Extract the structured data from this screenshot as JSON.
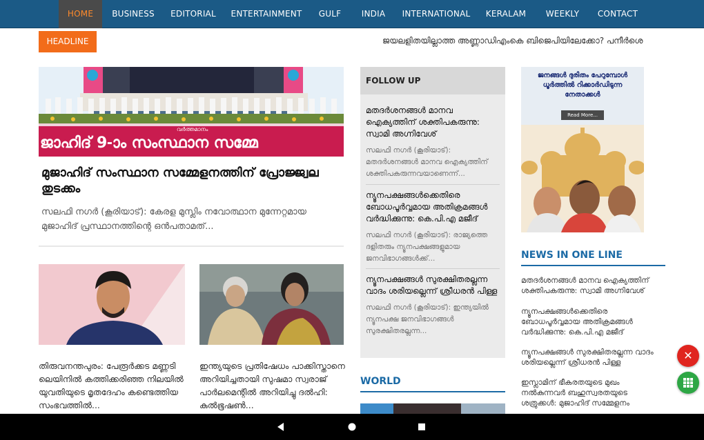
{
  "nav": {
    "items": [
      "HOME",
      "BUSINESS",
      "EDITORIAL",
      "ENTERTAINMENT",
      "GULF",
      "INDIA",
      "INTERNATIONAL",
      "KERALAM",
      "WEEKLY",
      "CONTACT"
    ],
    "active": "HOME"
  },
  "headline": {
    "label": "HEADLINE",
    "ticker": "ജയലളിതയില്ലാത്ത അണ്ണാഡിഎംകെ ബിജെപിയിലേക്കോ? പനീർശെ"
  },
  "hero": {
    "banner_text": "ജാഹിദ് 9-ാം സംസ്ഥാന സമ്മേ",
    "banner_logo": "വർത്തമാനം",
    "title": "മുജാഹിദ് സംസ്ഥാന സമ്മേളനത്തിന് പ്രോജ്ജ്വല തുടക്കം",
    "excerpt": "സലഫി നഗർ (കൂരിയാട്): കേരള മുസ്ലിം നവോത്ഥാന മുന്നേറ്റമായ മുജാഹിദ് പ്രസ്ഥാനത്തിന്റെ ഒൻപതാമത്..."
  },
  "cards": [
    {
      "text": "തിരുവനന്തപുരം: പേരൂർക്കട മണ്ണടി ലെയിനിൽ കത്തിക്കരിഞ്ഞ നിലയിൽ യുവതിയുടെ മൃതദേഹം കണ്ടെത്തിയ സംഭവത്തിൽ..."
    },
    {
      "text": "ഇന്ത്യയുടെ പ്രതിഷേധം പാക്കിസ്താനെ അറിയിച്ചതായി സുഷമാ സ്വരാജ് പാർലമെന്റിൽ അറിയിച്ചു ദൽഹി: കുൽഭൂഷൺ..."
    }
  ],
  "follow_up": {
    "heading": "FOLLOW UP",
    "items": [
      {
        "title": "മതദർശനങ്ങൾ മാനവ ഐക്യത്തിന് ശക്തിപകരുന്നു: സ്വാമി അഗ്നിവേശ്",
        "excerpt": "സലഫി നഗർ (കൂരിയാട്): മതദർശനങ്ങൾ മാനവ ഐക്യത്തിന് ശക്തിപകരുന്നവയാണെന്ന്..."
      },
      {
        "title": "ന്യൂനപക്ഷങ്ങൾക്കെതിരെ ബോധപൂർവ്വമായ അതിക്രമങ്ങൾ വർദ്ധിക്കുന്നു: കെ.പി.എ മജീദ്",
        "excerpt": "സലഫി നഗർ (കൂരിയാട്): രാജ്യത്തെ ദളിതരും ന്യൂനപക്ഷങ്ങളുമായ ജനവിഭാഗങ്ങൾക്ക്..."
      },
      {
        "title": "ന്യൂനപക്ഷങ്ങൾ സുരക്ഷിതരല്ലന്ന വാദം ശരിയല്ലെന്ന് ശ്രീധരൻ പിള്ള",
        "excerpt": "സലഫി നഗർ (കൂരിയാട്): ഇന്ത്യയിൽ ന്യൂനപക്ഷ ജനവിഭാഗങ്ങൾ സുരക്ഷിതരല്ലന്ന..."
      }
    ]
  },
  "world": {
    "heading": "WORLD"
  },
  "ad": {
    "headline": "ജനങ്ങൾ ദുരിതം പേറുമ്പോൾ ധൂർത്തിൽ റിക്കാർഡിടുന്ന നേതാക്കൾ",
    "button": "Read More..."
  },
  "news_in_one_line": {
    "heading": "NEWS IN ONE LINE",
    "items": [
      "മതദർശനങ്ങൾ മാനവ ഐക്യത്തിന് ശക്തിപകരുന്നു: സ്വാമി അഗ്നിവേശ്",
      "ന്യൂനപക്ഷങ്ങൾക്കെതിരെ ബോധപൂർവ്വമായ അതിക്രമങ്ങൾ വർദ്ധിക്കുന്നു: കെ.പി.എ മജീദ്",
      "ന്യൂനപക്ഷങ്ങൾ സുരക്ഷിതരല്ലന്ന വാദം ശരിയല്ലെന്ന് ശ്രീധരൻ പിള്ള",
      "ഇസ്ലാമിന് ഭീകരതയുടെ മുഖം നൽകുന്നവർ ബഹുസ്വരതയുടെ ശത്രുക്കൾ: മുജാഹിദ് സമ്മേളനം"
    ]
  },
  "fab": {
    "close_glyph": "✕"
  },
  "colors": {
    "nav": "#1b5a86",
    "headline": "#f26c1a",
    "accent": "#1b6aa5",
    "close": "#e0251f",
    "grid": "#2ea745"
  },
  "icons": [
    "close-icon",
    "grid-icon",
    "back-icon",
    "home-icon",
    "recents-icon"
  ]
}
